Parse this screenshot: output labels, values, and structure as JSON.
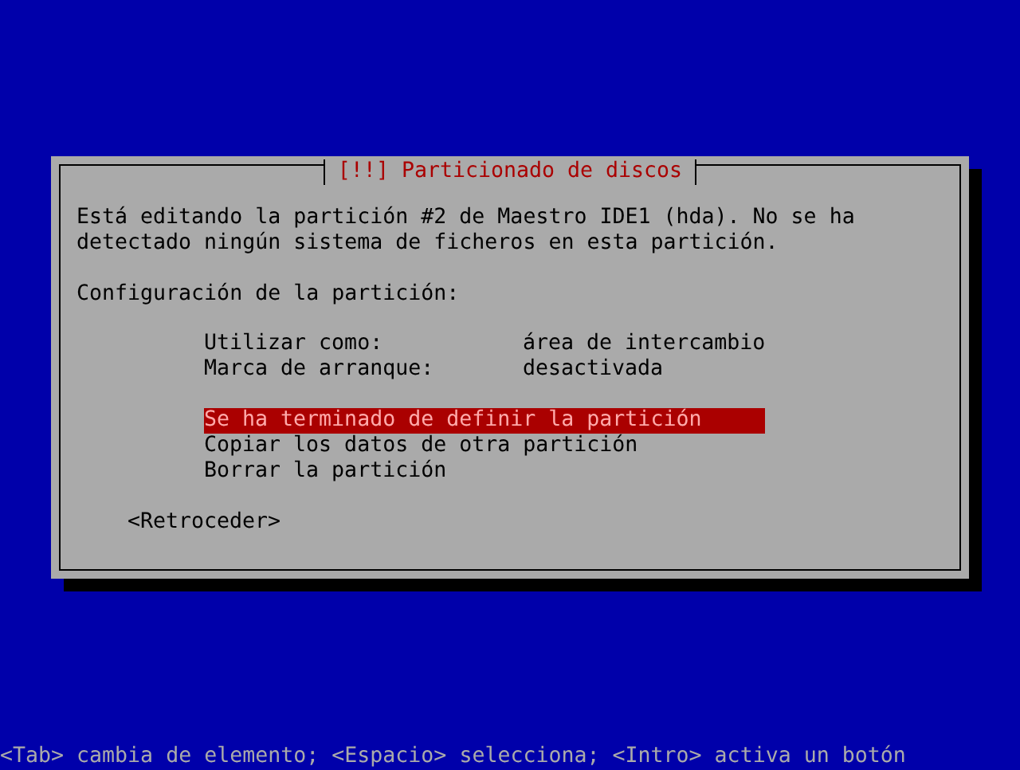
{
  "dialog": {
    "title": "[!!] Particionado de discos",
    "message": "Está editando la partición #2 de Maestro IDE1 (hda). No se ha detectado ningún sistema de ficheros en esta partición.",
    "section_label": "Configuración de la partición:",
    "settings": [
      {
        "label": "Utilizar como:",
        "value": "área de intercambio"
      },
      {
        "label": "Marca de arranque:",
        "value": "desactivada"
      }
    ],
    "options": [
      {
        "label": "Se ha terminado de definir la partición",
        "selected": true
      },
      {
        "label": "Copiar los datos de otra partición",
        "selected": false
      },
      {
        "label": "Borrar la partición",
        "selected": false
      }
    ],
    "back_button": "<Retroceder>"
  },
  "status_bar": "<Tab> cambia de elemento; <Espacio> selecciona; <Intro> activa un botón"
}
